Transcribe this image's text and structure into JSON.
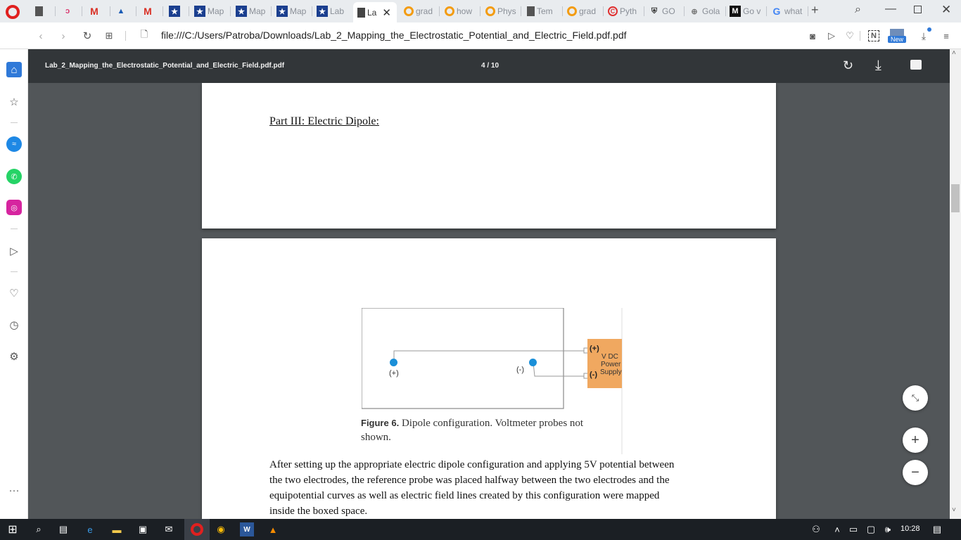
{
  "browser": {
    "tabs": [
      {
        "label": "",
        "icon": "document-icon"
      },
      {
        "label": "",
        "icon": "scribble-icon"
      },
      {
        "label": "",
        "icon": "gmail-icon"
      },
      {
        "label": "",
        "icon": "graduation-cap-icon"
      },
      {
        "label": "",
        "icon": "gmail-icon"
      },
      {
        "label": "",
        "icon": "star-icon"
      },
      {
        "label": "Map",
        "icon": "star-icon"
      },
      {
        "label": "Map",
        "icon": "star-icon"
      },
      {
        "label": "Map",
        "icon": "star-icon"
      },
      {
        "label": "Lab",
        "icon": "star-icon"
      },
      {
        "label": "La",
        "icon": "document-icon"
      },
      {
        "label": "grad",
        "icon": "orange-ring-icon"
      },
      {
        "label": "how",
        "icon": "orange-ring-icon"
      },
      {
        "label": "Phys",
        "icon": "orange-ring-icon"
      },
      {
        "label": "Tem",
        "icon": "document-icon"
      },
      {
        "label": "grad",
        "icon": "orange-ring-icon"
      },
      {
        "label": "Pyth",
        "icon": "red-c-icon"
      },
      {
        "label": "GO",
        "icon": "shield-icon"
      },
      {
        "label": "Gola",
        "icon": "globe-icon"
      },
      {
        "label": "Go v",
        "icon": "medium-icon"
      },
      {
        "label": "what",
        "icon": "google-icon"
      }
    ],
    "new_tab": "+",
    "url": "file:///C:/Users/Patroba/Downloads/Lab_2_Mapping_the_Electrostatic_Potential_and_Electric_Field.pdf.pdf",
    "new_badge": "New"
  },
  "pdf": {
    "filename": "Lab_2_Mapping_the_Electrostatic_Potential_and_Electric_Field.pdf.pdf",
    "page_indicator": "4 / 10",
    "page1": {
      "heading": "Part III: Electric Dipole:"
    },
    "page2": {
      "figure": {
        "plus_label": "(+)",
        "minus_label": "(-)",
        "terminal_plus": "(+)",
        "terminal_minus": "(-)",
        "power_line1": "V DC",
        "power_line2": "Power",
        "power_line3": "Supply",
        "caption_bold": "Figure 6.",
        "caption_text": " Dipole configuration. Voltmeter probes not",
        "caption_text2": "shown."
      },
      "paragraph_lines": [
        "After setting up the appropriate electric dipole configuration  and applying 5V potential  between",
        "the two electrodes, the reference probe was placed halfway between the two electrodes and the",
        "equipotential curves as well as electric field lines created by this configuration were mapped",
        "inside the boxed space."
      ]
    }
  },
  "taskbar": {
    "time": "10:28"
  },
  "colors": {
    "electrode": "#1a8fd8",
    "power_supply": "#f0a860",
    "pdf_toolbar": "#323639",
    "pdf_bg": "#525659"
  }
}
